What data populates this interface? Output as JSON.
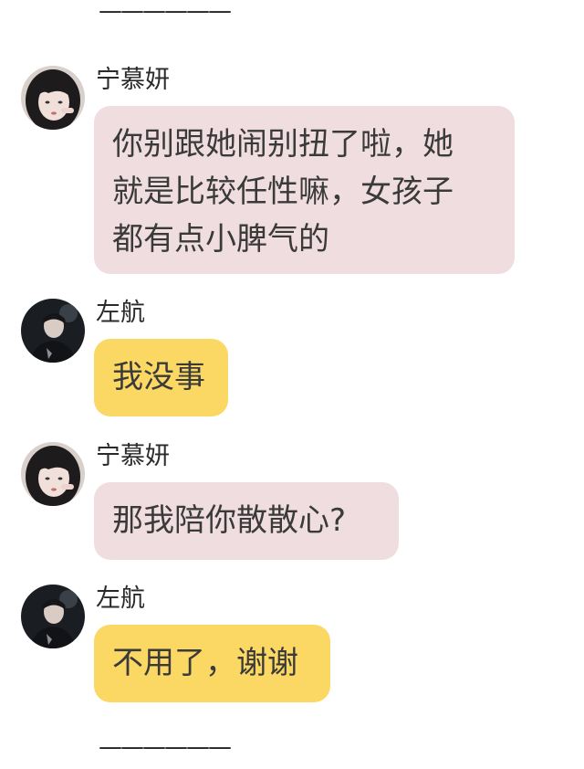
{
  "divider_top": "——————",
  "divider_bottom": "——————",
  "messages": [
    {
      "sender": "宁慕妍",
      "avatar_icon": "girl-avatar-icon",
      "bubble_color": "#f0dde0",
      "lines": [
        "你别跟她闹别扭了啦，她",
        "就是比较任性嘛，女孩子",
        "都有点小脾气的"
      ]
    },
    {
      "sender": "左航",
      "avatar_icon": "boy-avatar-icon",
      "bubble_color": "#fbd863",
      "lines": [
        "我没事"
      ]
    },
    {
      "sender": "宁慕妍",
      "avatar_icon": "girl-avatar-icon",
      "bubble_color": "#f0dde0",
      "lines": [
        "那我陪你散散心?"
      ]
    },
    {
      "sender": "左航",
      "avatar_icon": "boy-avatar-icon",
      "bubble_color": "#fbd863",
      "lines": [
        "不用了，谢谢"
      ]
    }
  ]
}
